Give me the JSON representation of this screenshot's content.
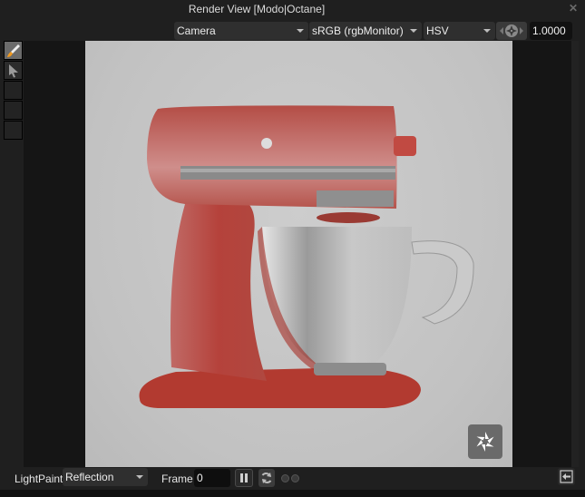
{
  "window": {
    "title": "Render View [Modo|Octane]",
    "close_icon": "close-x"
  },
  "toolbar": {
    "camera": {
      "selected": "Camera"
    },
    "color_space": {
      "selected": "sRGB (rgbMonitor)"
    },
    "color_mode": {
      "selected": "HSV"
    },
    "octane_button_icon": "octane-aperture-icon",
    "exposure_value": "1.0000"
  },
  "sidebar": {
    "tools": [
      {
        "name": "paint-brush",
        "icon": "brush-icon",
        "active": true
      },
      {
        "name": "select",
        "icon": "cursor-arrow-icon",
        "active": false
      },
      {
        "name": "empty-1",
        "icon": "",
        "active": false
      },
      {
        "name": "empty-2",
        "icon": "",
        "active": false
      },
      {
        "name": "empty-3",
        "icon": "",
        "active": false
      }
    ]
  },
  "render": {
    "subject": "Red stand mixer with stainless steel bowl",
    "colors": {
      "body": "#b5423b",
      "background": "#c4c4c4"
    },
    "watermark_icon": "octane-logo-icon"
  },
  "bottom": {
    "lightpaint_label": "LightPaint",
    "lightpaint_mode": "Reflection",
    "frame_label": "Frame",
    "frame_value": "0",
    "pause_icon": "pause-icon",
    "refresh_icon": "refresh-icon",
    "export_icon": "export-arrow-icon"
  }
}
